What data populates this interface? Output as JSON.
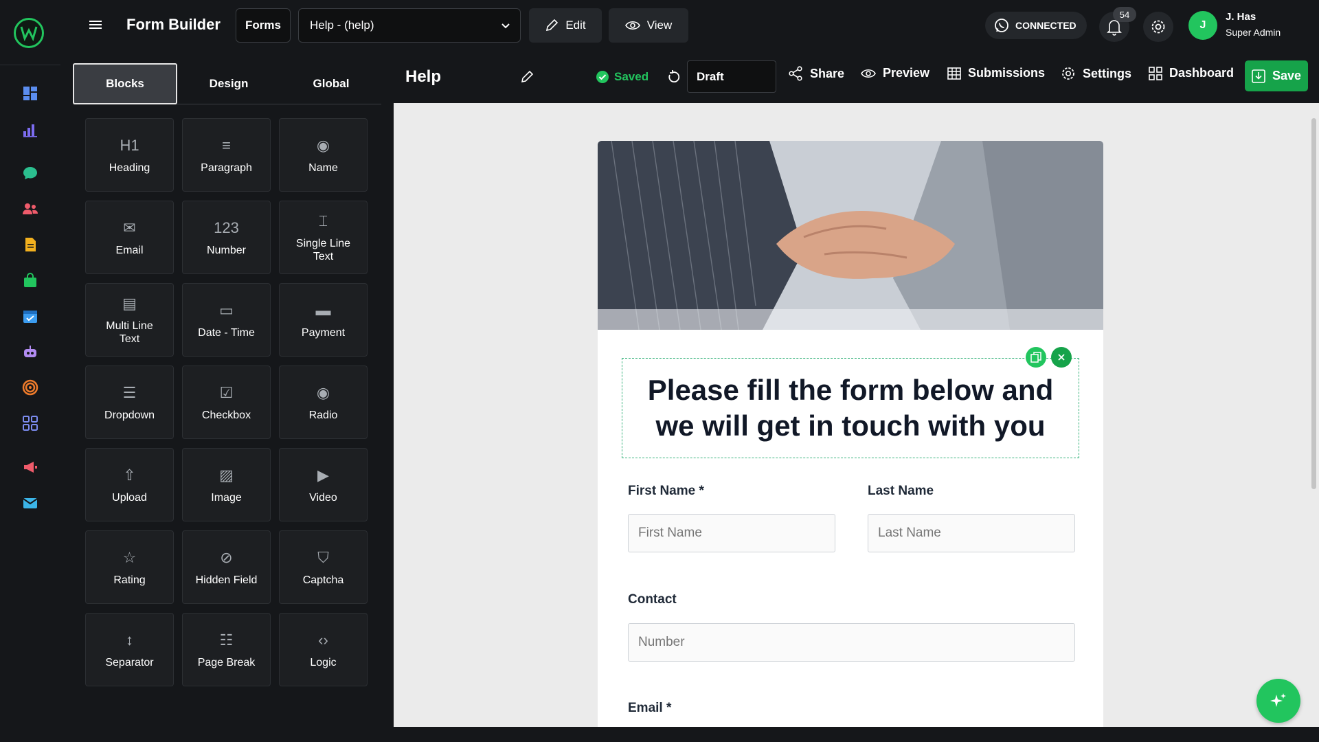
{
  "topbar": {
    "app_title": "Form Builder",
    "forms_label": "Forms",
    "form_select_value": "Help - (help)",
    "edit_label": "Edit",
    "view_label": "View",
    "connection_status": "CONNECTED",
    "notification_count": "54",
    "user_initial": "J",
    "user_name": "J. Has",
    "user_role": "Super Admin"
  },
  "panel": {
    "tabs": [
      {
        "label": "Blocks",
        "active": true
      },
      {
        "label": "Design",
        "active": false
      },
      {
        "label": "Global",
        "active": false
      }
    ],
    "blocks": [
      {
        "label": "Heading",
        "icon": "heading-icon",
        "glyph": "H1"
      },
      {
        "label": "Paragraph",
        "icon": "paragraph-icon",
        "glyph": "≡"
      },
      {
        "label": "Name",
        "icon": "user-icon",
        "glyph": "◉"
      },
      {
        "label": "Email",
        "icon": "envelope-icon",
        "glyph": "✉"
      },
      {
        "label": "Number",
        "icon": "number-icon",
        "glyph": "123"
      },
      {
        "label": "Single Line Text",
        "icon": "text-cursor-icon",
        "glyph": "⌶"
      },
      {
        "label": "Multi Line Text",
        "icon": "multiline-icon",
        "glyph": "▤"
      },
      {
        "label": "Date - Time",
        "icon": "calendar-icon",
        "glyph": "▭"
      },
      {
        "label": "Payment",
        "icon": "credit-card-icon",
        "glyph": "▬"
      },
      {
        "label": "Dropdown",
        "icon": "dropdown-icon",
        "glyph": "☰"
      },
      {
        "label": "Checkbox",
        "icon": "checkbox-icon",
        "glyph": "☑"
      },
      {
        "label": "Radio",
        "icon": "radio-icon",
        "glyph": "◉"
      },
      {
        "label": "Upload",
        "icon": "upload-icon",
        "glyph": "⇧"
      },
      {
        "label": "Image",
        "icon": "image-icon",
        "glyph": "▨"
      },
      {
        "label": "Video",
        "icon": "video-icon",
        "glyph": "▶"
      },
      {
        "label": "Rating",
        "icon": "star-icon",
        "glyph": "☆"
      },
      {
        "label": "Hidden Field",
        "icon": "eye-off-icon",
        "glyph": "⊘"
      },
      {
        "label": "Captcha",
        "icon": "shield-icon",
        "glyph": "⛉"
      },
      {
        "label": "Separator",
        "icon": "separator-icon",
        "glyph": "↕"
      },
      {
        "label": "Page Break",
        "icon": "list-icon",
        "glyph": "☷"
      },
      {
        "label": "Logic",
        "icon": "code-icon",
        "glyph": "‹›"
      }
    ]
  },
  "editor": {
    "doc_title": "Help",
    "save_status": "Saved",
    "status_value": "Draft",
    "share_label": "Share",
    "preview_label": "Preview",
    "submissions_label": "Submissions",
    "settings_label": "Settings",
    "dashboard_label": "Dashboard",
    "save_label": "Save"
  },
  "form": {
    "heading": "Please fill the form below and we will get in touch with you",
    "first_name_label": "First Name *",
    "first_name_placeholder": "First Name",
    "last_name_label": "Last Name",
    "last_name_placeholder": "Last Name",
    "contact_label": "Contact",
    "contact_placeholder": "Number",
    "email_label": "Email *"
  },
  "colors": {
    "accent": "#22c55e",
    "background": "#15171a",
    "canvas": "#ebebeb"
  }
}
